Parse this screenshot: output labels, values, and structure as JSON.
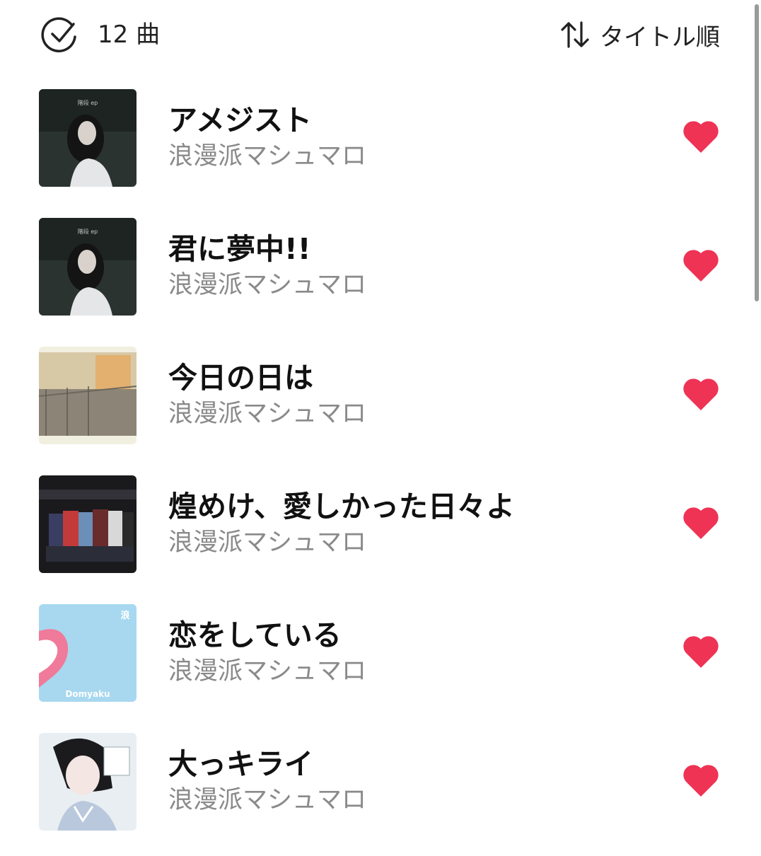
{
  "header": {
    "count_label": "12 曲",
    "sort_label": "タイトル順"
  },
  "icons": {
    "select_all": "check-circle-icon",
    "sort": "sort-arrows-icon",
    "like": "heart-icon"
  },
  "colors": {
    "heart": "#ee3355",
    "secondary_text": "#8a8a8a",
    "primary_text": "#111111"
  },
  "songs": [
    {
      "title": "アメジスト",
      "artist": "浪漫派マシュマロ",
      "liked": true
    },
    {
      "title": "君に夢中!!",
      "artist": "浪漫派マシュマロ",
      "liked": true
    },
    {
      "title": "今日の日は",
      "artist": "浪漫派マシュマロ",
      "liked": true
    },
    {
      "title": "煌めけ、愛しかった日々よ",
      "artist": "浪漫派マシュマロ",
      "liked": true
    },
    {
      "title": "恋をしている",
      "artist": "浪漫派マシュマロ",
      "liked": true
    },
    {
      "title": "大っキライ",
      "artist": "浪漫派マシュマロ",
      "liked": true
    }
  ],
  "artwork": {
    "cover_text_1": "階段 ep",
    "cover_text_2": "階段 ep",
    "cover_text_5": "Domyaku"
  }
}
